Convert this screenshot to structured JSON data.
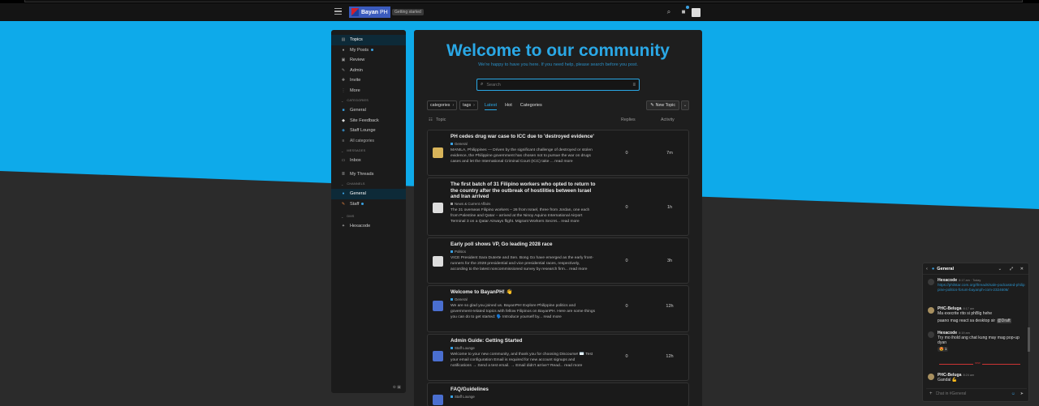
{
  "header": {
    "brand": "Bayan",
    "brand_suffix": "PH",
    "badge": "Getting started"
  },
  "sidebar": {
    "items_top": [
      {
        "label": "Topics",
        "icon": "topics-icon"
      },
      {
        "label": "My Posts",
        "icon": "user-icon"
      },
      {
        "label": "Review",
        "icon": "review-icon"
      },
      {
        "label": "Admin",
        "icon": "wrench-icon"
      },
      {
        "label": "Invite",
        "icon": "invite-icon"
      },
      {
        "label": "More",
        "icon": "more-icon"
      }
    ],
    "section_categories": "CATEGORIES",
    "categories": [
      {
        "label": "General",
        "color": "#3aa0e0"
      },
      {
        "label": "Site Feedback",
        "color": "#dddddd"
      },
      {
        "label": "Staff Lounge",
        "color": "#3aa0e0"
      },
      {
        "label": "All categories",
        "color": "#888888"
      }
    ],
    "section_messages": "MESSAGES",
    "messages": [
      {
        "label": "Inbox"
      },
      {
        "label": "My Threads"
      }
    ],
    "section_channels": "CHANNELS",
    "channels": [
      {
        "label": "General"
      },
      {
        "label": "Staff"
      }
    ],
    "section_dms": "DMS",
    "dms": [
      {
        "label": "Hexacode"
      }
    ]
  },
  "main": {
    "welcome_title": "Welcome to our community",
    "welcome_sub": "We're happy to have you here. If you need help, please search before you post.",
    "search_placeholder": "Search",
    "filters": {
      "categories": "categories",
      "tags": "tags"
    },
    "tabs": [
      "Latest",
      "Hot",
      "Categories"
    ],
    "new_topic": "New Topic",
    "columns": {
      "topic": "Topic",
      "replies": "Replies",
      "activity": "Activity"
    },
    "topics": [
      {
        "title": "PH cedes drug war case to ICC due to 'destroyed evidence'",
        "category": "General",
        "cat_color": "#3aa0e0",
        "excerpt": "MANILA, Philippines — Driven by the significant challenge of destroyed or stolen evidence, the Philippine government has chosen not to pursue the war on drugs cases and let the International Criminal Court (ICC) take ... read more",
        "replies": "0",
        "activity": "7m",
        "avatar_color": "#d8b45a"
      },
      {
        "title": "The first batch of 31 Filipino workers who opted to return to the country after the outbreak of hostilities between Israel and Iran arrived",
        "category": "News & Current Affairs",
        "cat_color": "#9a9a9a",
        "excerpt": "The 31 overseas Filipino workers – 26 from Israel, three from Jordan, one each from Palestine and Qatar – arrived at the Ninoy Aquino International Airport Terminal 3 on a Qatar Airways flight. Migrant Workers Secret... read more",
        "replies": "0",
        "activity": "1h",
        "avatar_color": "#dddddd"
      },
      {
        "title": "Early poll shows VP, Go leading 2028 race",
        "category": "Politics",
        "cat_color": "#3aa0e0",
        "excerpt": "VICE President Sara Duterte and Sen. Bong Go have emerged as the early front-runners for the 2028 presidential and vice presidential races, respectively, according to the latest noncommissioned survey by research firm... read more",
        "replies": "0",
        "activity": "3h",
        "avatar_color": "#dddddd"
      },
      {
        "title": "Welcome to BayanPH! 👋",
        "category": "General",
        "cat_color": "#3aa0e0",
        "excerpt": "We are so glad you joined us. BayanPH! Explore Philippine politics and government-related topics with fellow Filipinos on BayanPH. Here are some things you can do to get started: 🗣️ Introduce yourself by... read more",
        "replies": "0",
        "activity": "12h",
        "avatar_color": "#4a6fd0"
      },
      {
        "title": "Admin Guide: Getting Started",
        "category": "Staff Lounge",
        "cat_color": "#3aa0e0",
        "excerpt": "Welcome to your new community, and thank you for choosing Discourse! ✉️ Test your email configuration Email is required for new account signups and notifications → Send a test email. → Email didn't arrive? Read... read more",
        "replies": "0",
        "activity": "12h",
        "avatar_color": "#4a6fd0"
      },
      {
        "title": "FAQ/Guidelines",
        "category": "Staff Lounge",
        "cat_color": "#3aa0e0",
        "excerpt": "",
        "replies": "",
        "activity": "",
        "avatar_color": "#4a6fd0"
      }
    ]
  },
  "chat": {
    "channel": "General",
    "messages": [
      {
        "name": "Hexacode",
        "time": "8:17 am · Today",
        "text": "",
        "link": "https://philstar.com.org/threads/sale-podcasted-philippine-politics-forum-bayanph-com-2324606/"
      },
      {
        "name": "PHC-Beluga",
        "time": "8:17 am",
        "text": "Ma execrite rito si phBlg hehe",
        "text2": "paano mag react sa desktop sir",
        "mention": "@Draft"
      },
      {
        "name": "Hexacode",
        "time": "8:19 am",
        "text": "Try mo ihold ang chat kung may mag pop-up dyan",
        "reaction": "😍 1"
      },
      {
        "name": "PHC-Beluga",
        "time": "8:24 am",
        "text": "Gandal 💪"
      }
    ],
    "divider_label": "new",
    "input_placeholder": "Chat in #General"
  }
}
